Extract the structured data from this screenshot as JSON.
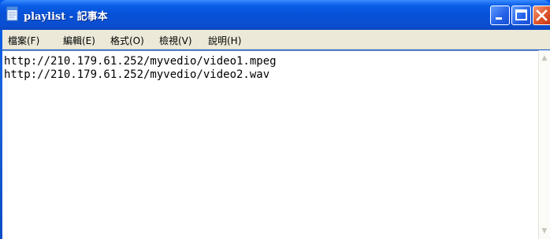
{
  "window": {
    "title": "playlist - 記事本"
  },
  "menu": [
    {
      "label": "檔案(F)"
    },
    {
      "label": "編輯(E)"
    },
    {
      "label": "格式(O)"
    },
    {
      "label": "檢視(V)"
    },
    {
      "label": "說明(H)"
    }
  ],
  "document": {
    "lines": [
      "http://210.179.61.252/myvedio/video1.mpeg",
      "http://210.179.61.252/myvedio/video2.wav"
    ]
  },
  "icons": {
    "app": "notepad-icon",
    "minimize": "minimize-icon",
    "maximize": "maximize-icon",
    "close": "close-icon"
  },
  "colors": {
    "titlebar": "#0a5fe8",
    "menubar": "#ece9d8",
    "close_button": "#e0562c"
  }
}
